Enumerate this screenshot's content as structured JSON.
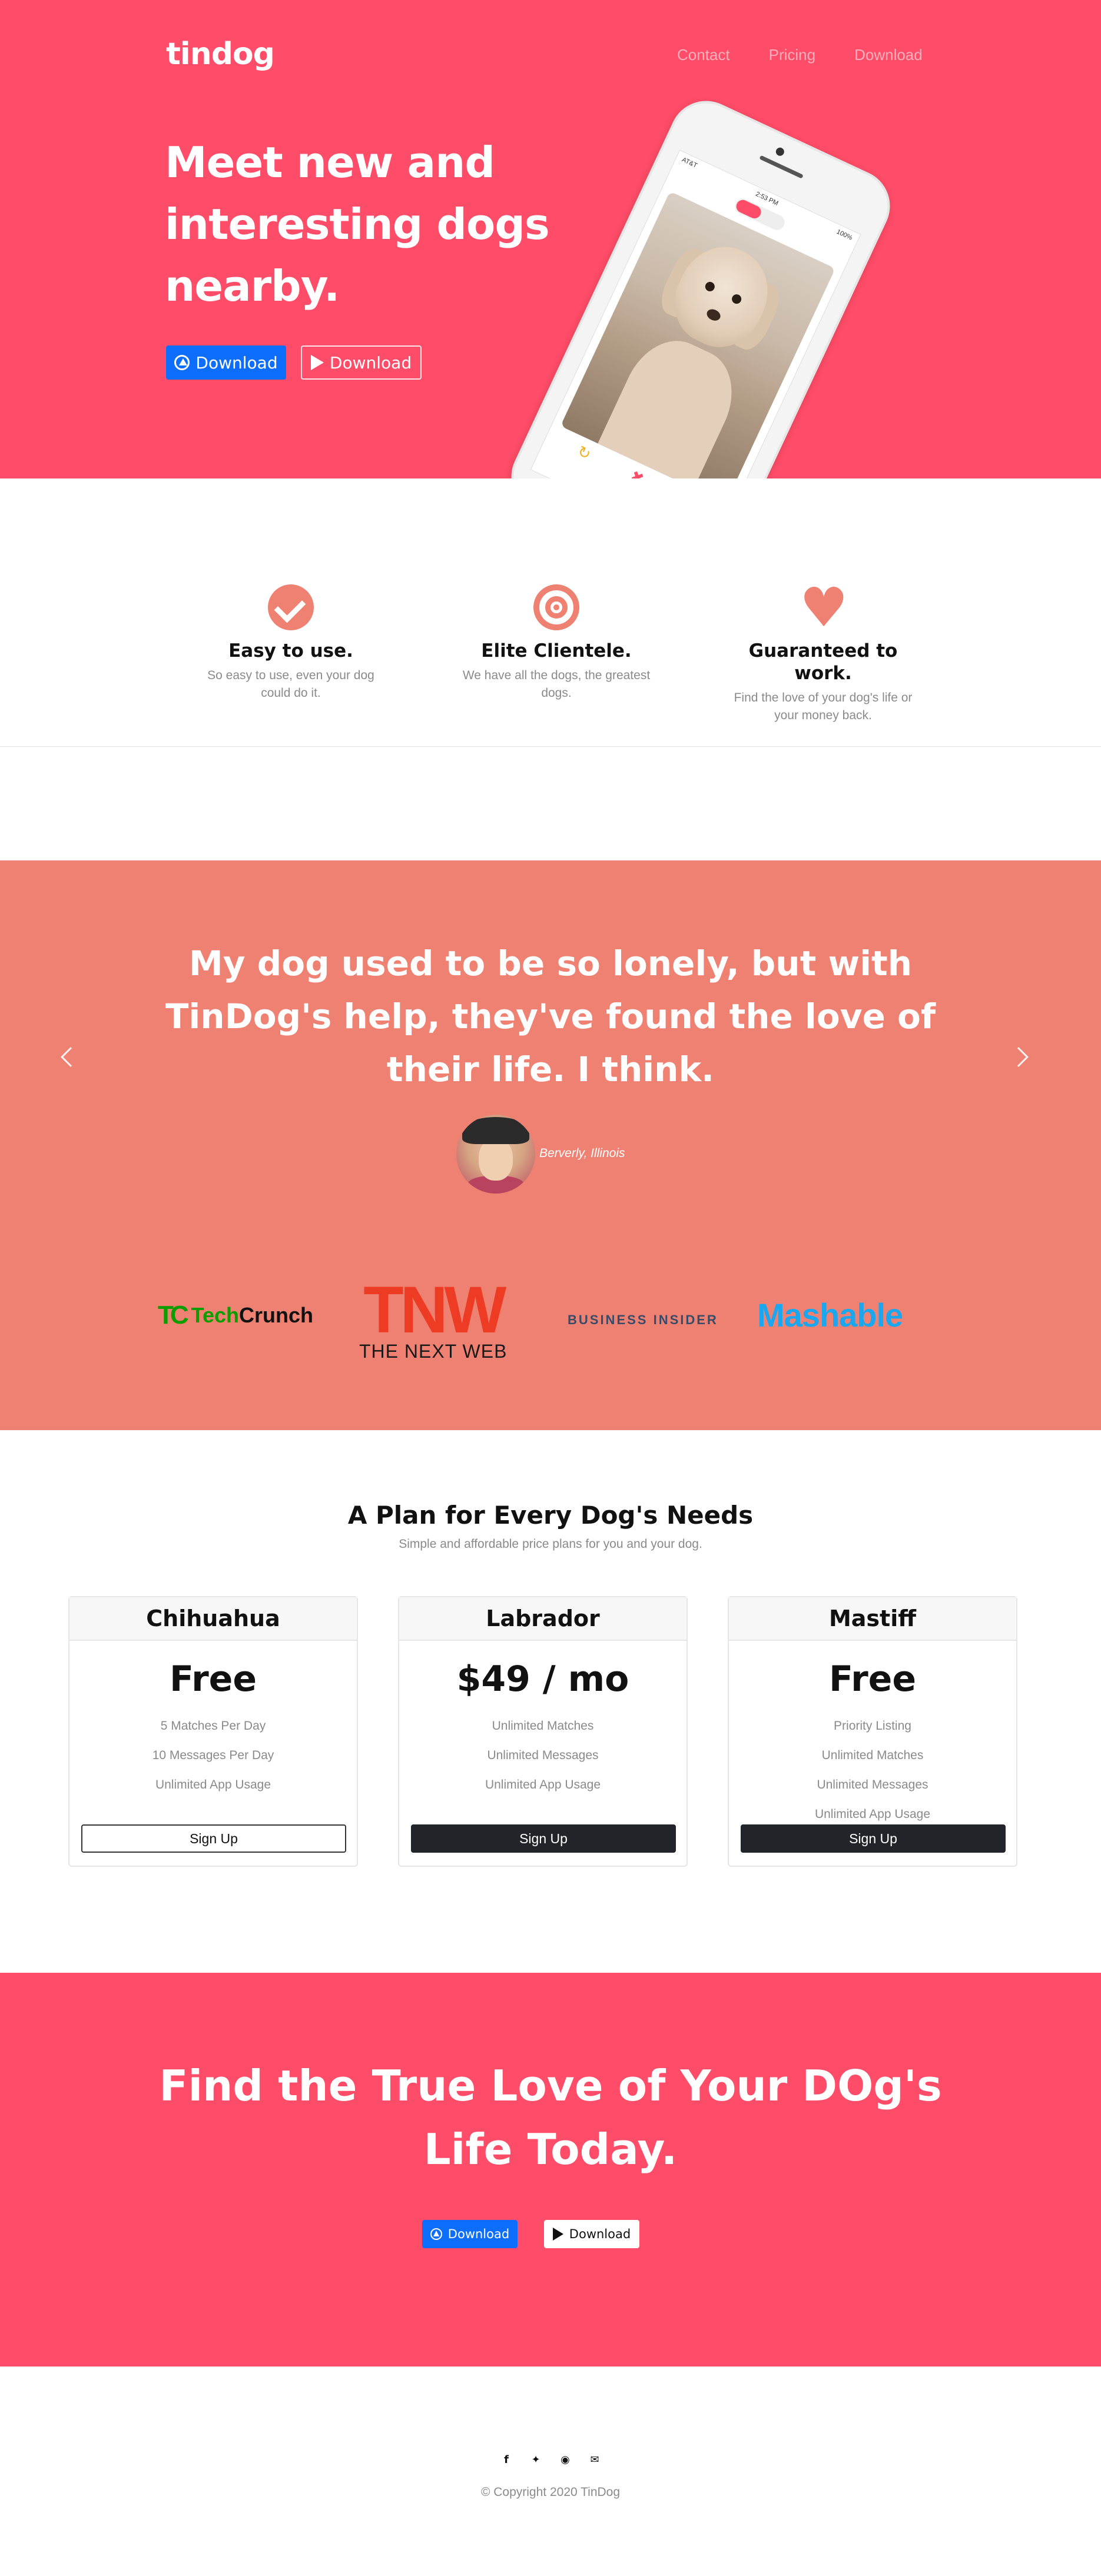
{
  "brand": "tindog",
  "nav": {
    "items": [
      "Contact",
      "Pricing",
      "Download"
    ]
  },
  "hero": {
    "title": "Meet new and interesting dogs nearby.",
    "primary_button": "Download",
    "secondary_button": "Download",
    "phone": {
      "carrier": "AT&T",
      "time": "2:53 PM",
      "battery": "100%"
    }
  },
  "features": [
    {
      "icon": "check-circle-icon",
      "title": "Easy to use.",
      "text": "So easy to use, even your dog could do it."
    },
    {
      "icon": "bullseye-icon",
      "title": "Elite Clientele.",
      "text": "We have all the dogs, the greatest dogs."
    },
    {
      "icon": "heart-icon",
      "title": "Guaranteed to work.",
      "text": "Find the love of your dog's life or your money back."
    }
  ],
  "testimonial": {
    "quote": "My dog used to be so lonely, but with TinDog's help, they've found the love of their life. I think.",
    "author": "Berverly, Illinois"
  },
  "press": {
    "techcrunch_mark": "TC",
    "techcrunch_a": "Tech",
    "techcrunch_b": "Crunch",
    "tnw_mark": "TNW",
    "tnw_text": "THE NEXT WEB",
    "business_insider": "BUSINESS INSIDER",
    "mashable": "Mashable"
  },
  "pricing": {
    "title": "A Plan for Every Dog's Needs",
    "subtitle": "Simple and affordable price plans for you and your dog.",
    "plans": [
      {
        "name": "Chihuahua",
        "price": "Free",
        "features": [
          "5 Matches Per Day",
          "10 Messages Per Day",
          "Unlimited App Usage"
        ],
        "button": "Sign Up"
      },
      {
        "name": "Labrador",
        "price": "$49 / mo",
        "features": [
          "Unlimited Matches",
          "Unlimited Messages",
          "Unlimited App Usage"
        ],
        "button": "Sign Up"
      },
      {
        "name": "Mastiff",
        "price": "Free",
        "features": [
          "Priority Listing",
          "Unlimited Matches",
          "Unlimited Messages",
          "Unlimited App Usage"
        ],
        "button": "Sign Up"
      }
    ]
  },
  "cta": {
    "title": "Find the True Love of Your DOg's Life Today.",
    "primary_button": "Download",
    "secondary_button": "Download"
  },
  "footer": {
    "social_icons": [
      "facebook-icon",
      "twitter-icon",
      "instagram-icon",
      "envelope-icon"
    ],
    "copyright": "© Copyright 2020 TinDog"
  },
  "colors": {
    "hero_bg": "#ff4c68",
    "accent": "#ef8172",
    "primary_button": "#0d6efd",
    "dark_button": "#212529"
  }
}
